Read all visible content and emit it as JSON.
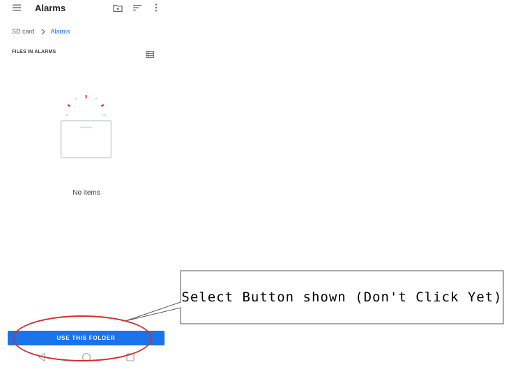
{
  "appbar": {
    "title": "Alarms",
    "icons": [
      "menu-icon",
      "create-new-folder-icon",
      "sort-icon",
      "more-vert-icon"
    ]
  },
  "breadcrumb": {
    "root": "SD card",
    "current": "Alarms",
    "separator_icon": "chevron-right-icon"
  },
  "section": {
    "title": "FILES IN ALARMS",
    "view_toggle_icon": "list-view-icon"
  },
  "empty_state": {
    "text": "No items",
    "illustration": "empty-folder-sparkle"
  },
  "primary_button": {
    "label": "USE THIS FOLDER"
  },
  "navbar": {
    "icons": [
      "back-icon",
      "home-icon",
      "recents-icon"
    ]
  },
  "annotation": {
    "callout_text": "Select Button shown (Don't Click Yet)",
    "highlight_color": "#d32f2f"
  },
  "colors": {
    "accent": "#1a73e8",
    "text_primary": "#202124",
    "text_secondary": "#5f6368"
  }
}
